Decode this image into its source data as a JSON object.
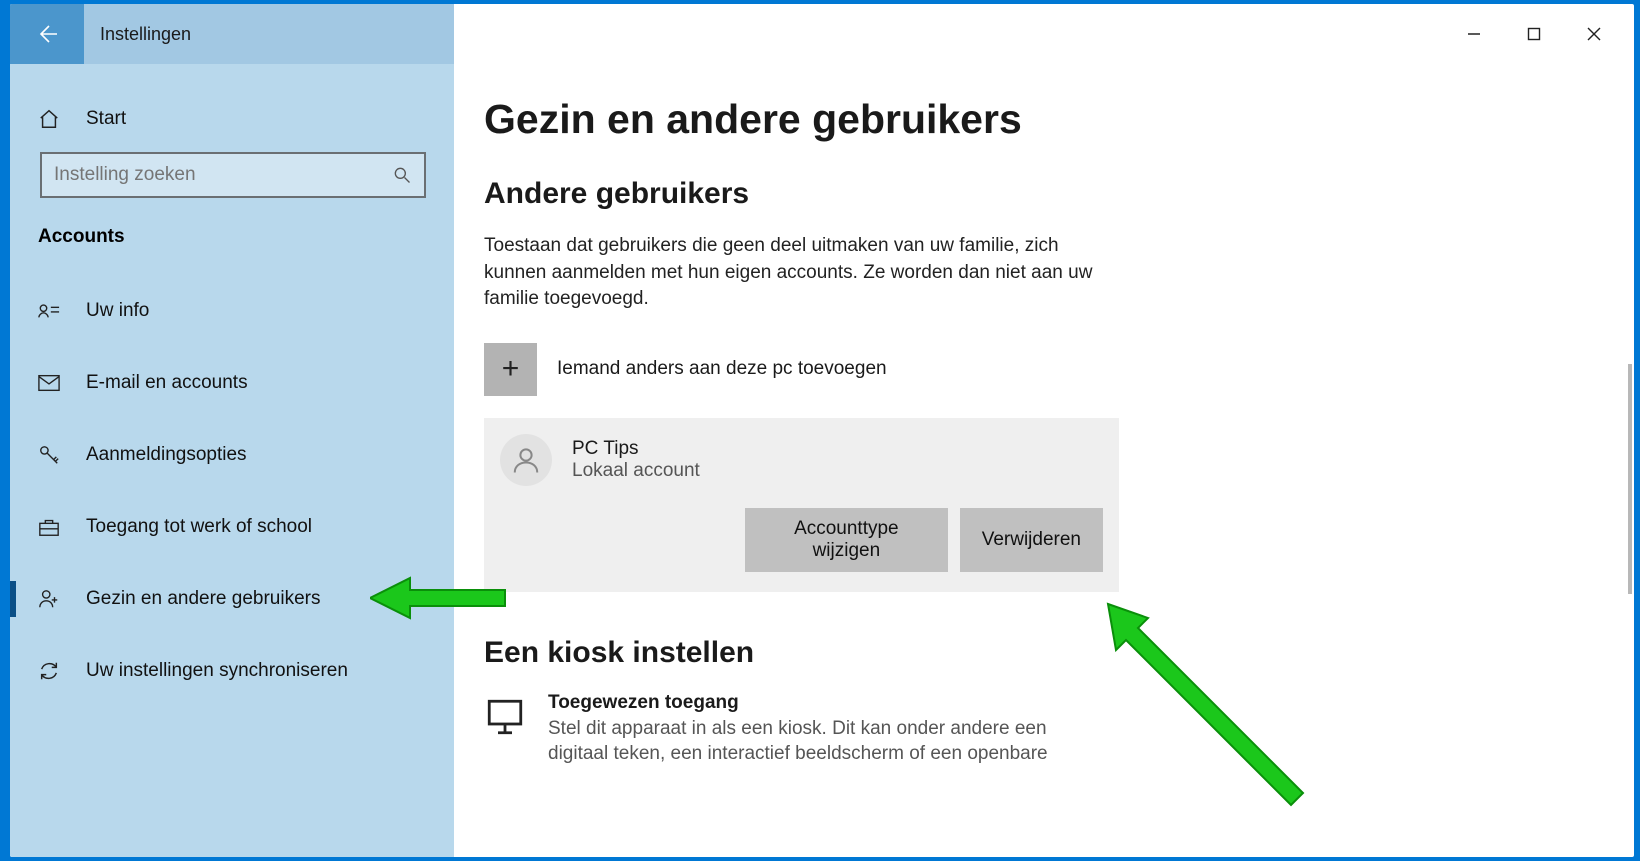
{
  "window": {
    "title": "Instellingen"
  },
  "search": {
    "placeholder": "Instelling zoeken"
  },
  "sidebar": {
    "home": "Start",
    "category": "Accounts",
    "items": [
      {
        "label": "Uw info"
      },
      {
        "label": "E-mail en accounts"
      },
      {
        "label": "Aanmeldingsopties"
      },
      {
        "label": "Toegang tot werk of school"
      },
      {
        "label": "Gezin en andere gebruikers"
      },
      {
        "label": "Uw instellingen synchroniseren"
      }
    ]
  },
  "main": {
    "title": "Gezin en andere gebruikers",
    "other_users_heading": "Andere gebruikers",
    "other_users_desc": "Toestaan dat gebruikers die geen deel uitmaken van uw familie, zich kunnen aanmelden met hun eigen accounts. Ze worden dan niet aan uw familie toegevoegd.",
    "add_label": "Iemand anders aan deze pc toevoegen",
    "account": {
      "name": "PC Tips",
      "type": "Lokaal account",
      "change_type": "Accounttype wijzigen",
      "remove": "Verwijderen"
    },
    "kiosk_heading": "Een kiosk instellen",
    "kiosk_title": "Toegewezen toegang",
    "kiosk_desc": "Stel dit apparaat in als een kiosk. Dit kan onder andere een digitaal teken, een interactief beeldscherm of een openbare"
  }
}
